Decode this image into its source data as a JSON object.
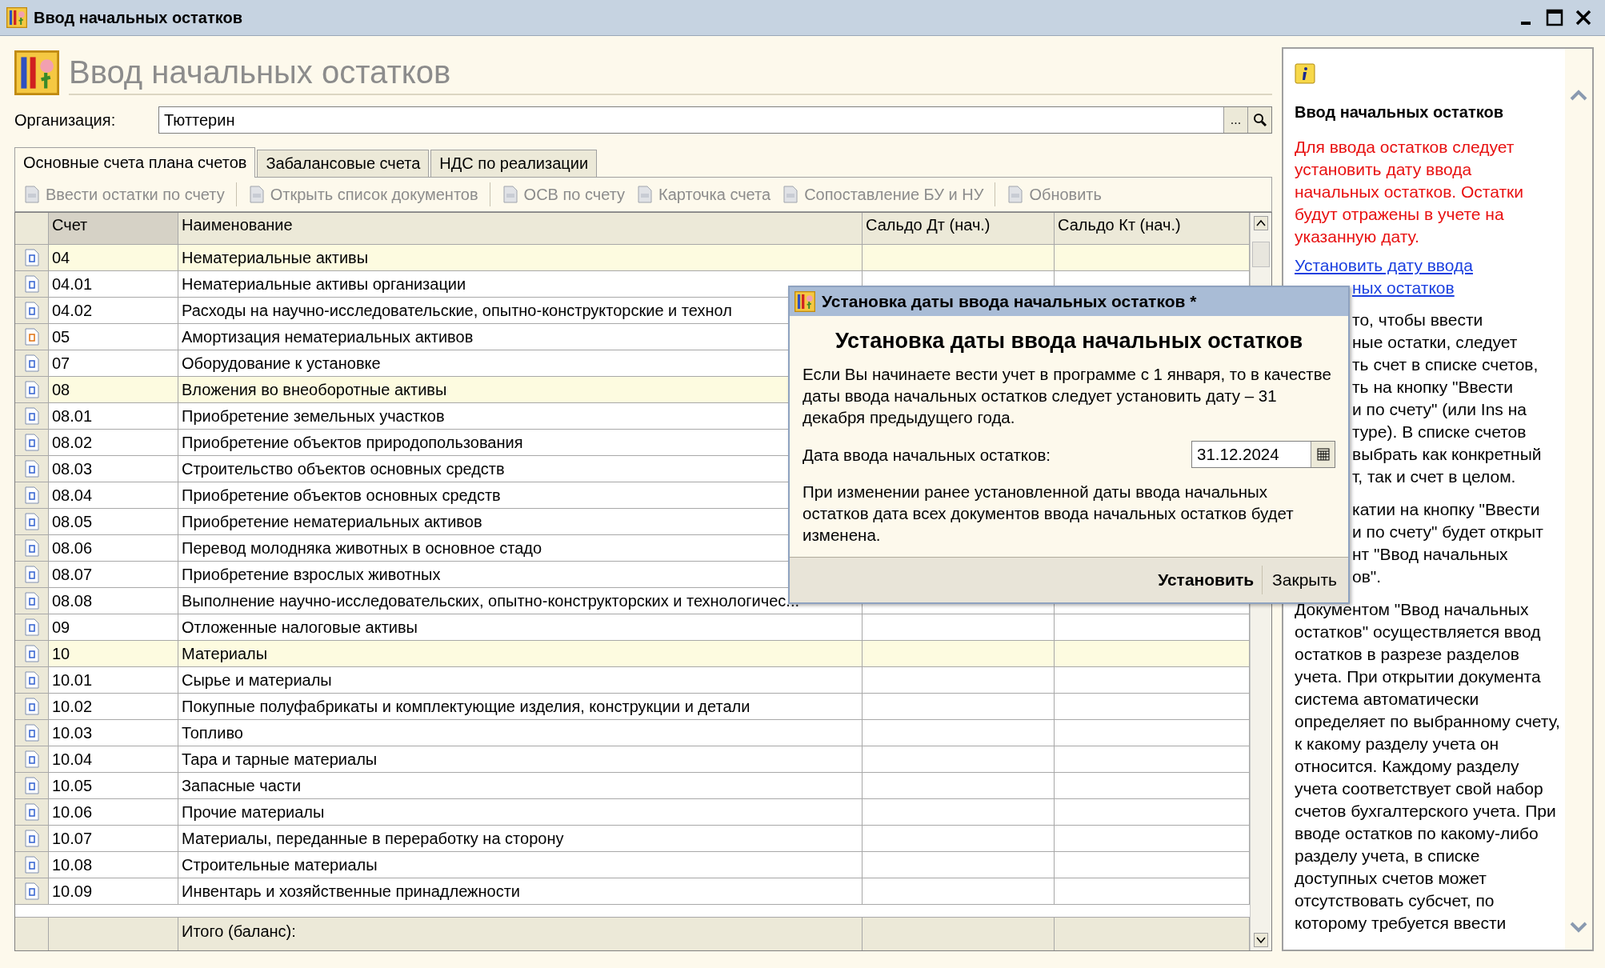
{
  "window": {
    "title": "Ввод начальных остатков"
  },
  "header": {
    "title": "Ввод начальных остатков"
  },
  "organization": {
    "label": "Организация:",
    "value": "Тюттерин",
    "choose_button": "..."
  },
  "tabs": [
    {
      "label": "Основные счета плана счетов",
      "selected": true
    },
    {
      "label": "Забалансовые счета",
      "selected": false
    },
    {
      "label": "НДС по реализации",
      "selected": false
    }
  ],
  "toolbar_groups": [
    [
      {
        "label": "Ввести остатки по счету",
        "disabled": true
      }
    ],
    [
      {
        "label": "Открыть список документов",
        "disabled": true
      }
    ],
    [
      {
        "label": "ОСВ по счету",
        "disabled": true
      },
      {
        "label": "Карточка счета",
        "disabled": true
      },
      {
        "label": "Сопоставление БУ и НУ",
        "disabled": true
      }
    ],
    [
      {
        "label": "Обновить",
        "disabled": true
      }
    ]
  ],
  "table": {
    "columns": [
      "Счет",
      "Наименование",
      "Сальдо Дт (нач.)",
      "Сальдо Кт (нач.)"
    ],
    "rows": [
      {
        "kind": "active",
        "highlighted": true,
        "account": "04",
        "name": "Нематериальные активы"
      },
      {
        "kind": "active",
        "highlighted": false,
        "account": "04.01",
        "name": "Нематериальные активы организации"
      },
      {
        "kind": "active",
        "highlighted": false,
        "account": "04.02",
        "name": "Расходы на научно-исследовательские, опытно-конструкторские и технол"
      },
      {
        "kind": "passive",
        "highlighted": false,
        "account": "05",
        "name": "Амортизация нематериальных активов"
      },
      {
        "kind": "active",
        "highlighted": false,
        "account": "07",
        "name": "Оборудование к установке"
      },
      {
        "kind": "active",
        "highlighted": true,
        "account": "08",
        "name": "Вложения во внеоборотные активы"
      },
      {
        "kind": "active",
        "highlighted": false,
        "account": "08.01",
        "name": "Приобретение земельных участков"
      },
      {
        "kind": "active",
        "highlighted": false,
        "account": "08.02",
        "name": "Приобретение объектов природопользования"
      },
      {
        "kind": "active",
        "highlighted": false,
        "account": "08.03",
        "name": "Строительство объектов основных средств"
      },
      {
        "kind": "active",
        "highlighted": false,
        "account": "08.04",
        "name": "Приобретение объектов основных средств"
      },
      {
        "kind": "active",
        "highlighted": false,
        "account": "08.05",
        "name": "Приобретение нематериальных активов"
      },
      {
        "kind": "active",
        "highlighted": false,
        "account": "08.06",
        "name": "Перевод молодняка животных в основное стадо"
      },
      {
        "kind": "active",
        "highlighted": false,
        "account": "08.07",
        "name": "Приобретение взрослых животных"
      },
      {
        "kind": "active",
        "highlighted": false,
        "account": "08.08",
        "name": "Выполнение научно-исследовательских, опытно-конструкторских и технологичес..."
      },
      {
        "kind": "active",
        "highlighted": false,
        "account": "09",
        "name": "Отложенные налоговые активы"
      },
      {
        "kind": "active",
        "highlighted": true,
        "account": "10",
        "name": "Материалы"
      },
      {
        "kind": "active",
        "highlighted": false,
        "account": "10.01",
        "name": "Сырье и материалы"
      },
      {
        "kind": "active",
        "highlighted": false,
        "account": "10.02",
        "name": "Покупные полуфабрикаты и комплектующие изделия, конструкции и детали"
      },
      {
        "kind": "active",
        "highlighted": false,
        "account": "10.03",
        "name": "Топливо"
      },
      {
        "kind": "active",
        "highlighted": false,
        "account": "10.04",
        "name": "Тара и тарные материалы"
      },
      {
        "kind": "active",
        "highlighted": false,
        "account": "10.05",
        "name": "Запасные части"
      },
      {
        "kind": "active",
        "highlighted": false,
        "account": "10.06",
        "name": "Прочие материалы"
      },
      {
        "kind": "active",
        "highlighted": false,
        "account": "10.07",
        "name": "Материалы, переданные в переработку на сторону"
      },
      {
        "kind": "active",
        "highlighted": false,
        "account": "10.08",
        "name": "Строительные материалы"
      },
      {
        "kind": "active",
        "highlighted": false,
        "account": "10.09",
        "name": "Инвентарь и хозяйственные принадлежности"
      }
    ],
    "footer_label": "Итого (баланс):"
  },
  "help_panel": {
    "title": "Ввод начальных остатков",
    "warning": "Для ввода остатков следует установить дату ввода начальных остатков. Остатки будут отражены в учете на указанную дату.",
    "link_lines": [
      "Установить дату ввода",
      "ных остатков"
    ],
    "cut_paragraphs": [
      [
        {
          "text": "то, чтобы ввести",
          "cut": true
        },
        {
          "text": "ные остатки, следует",
          "cut": true
        },
        {
          "text": "ть счет в списке счетов,",
          "cut": true
        },
        {
          "text": "ть на кнопку \"Ввести",
          "cut": true
        },
        {
          "text": "и по счету\" (или Ins на",
          "cut": true
        },
        {
          "text": "туре). В списке счетов",
          "cut": true
        },
        {
          "text": "выбрать как конкретный",
          "cut": true
        },
        {
          "text": "т, так и счет в целом.",
          "cut": true
        }
      ],
      [
        {
          "text": "катии на кнопку \"Ввести",
          "cut": true
        },
        {
          "text": "и по счету\" будет открыт",
          "cut": true
        },
        {
          "text": "нт \"Ввод начальных",
          "cut": true
        },
        {
          "text": "ов\".",
          "cut": true
        }
      ]
    ],
    "paragraph": "Документом \"Ввод начальных остатков\" осуществляется ввод остатков в разрезе разделов учета. При открытии документа система автоматически определяет по выбранному счету, к какому разделу учета он относится. Каждому разделу учета соответствует свой набор счетов бухгалтерского учета. При вводе остатков по какому-либо разделу учета, в списке доступных счетов может отсутствовать субсчет, по которому требуется ввести"
  },
  "dialog": {
    "title": "Установка даты ввода начальных остатков *",
    "heading": "Установка даты ввода начальных остатков",
    "intro": "Если Вы начинаете вести учет в программе с 1 января, то в качестве даты ввода начальных остатков следует установить дату – 31 декабря предыдущего года.",
    "date_label": "Дата ввода начальных остатков:",
    "date_value": "31.12.2024",
    "note": "При изменении ранее установленной даты ввода начальных остатков дата всех документов ввода начальных остатков будет изменена.",
    "buttons": [
      {
        "label": "Установить",
        "default": true
      },
      {
        "label": "Закрыть",
        "default": false
      }
    ]
  }
}
